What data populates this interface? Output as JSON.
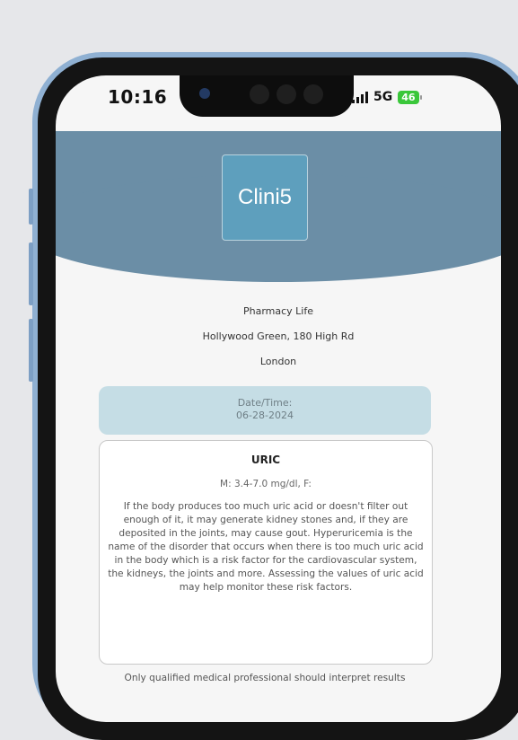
{
  "status_bar": {
    "time": "10:16",
    "network": "5G",
    "battery": "46"
  },
  "app": {
    "logo_text": "Clini5"
  },
  "pharmacy": {
    "name": "Pharmacy Life",
    "address": "Hollywood Green, 180 High Rd",
    "city": "London"
  },
  "date_time": {
    "label": "Date/Time:",
    "value": "06-28-2024"
  },
  "test_card": {
    "title": "URIC",
    "range": "M: 3.4-7.0 mg/dl, F:",
    "description": "If the body produces too much uric acid or doesn't filter out enough of it, it may generate kidney stones and, if they are deposited in the joints, may cause gout. Hyperuricemia is the name of the disorder that occurs when there is too much uric acid in the body which is a risk factor for the cardiovascular system, the kidneys, the joints and more. Assessing the values of uric acid may help monitor these risk factors."
  },
  "footer_note": "Only qualified medical professional should interpret results",
  "colors": {
    "header": "#6b8ea6",
    "logo_bg": "#5e9fbd",
    "date_box": "#c5dde5",
    "phone_frame": "#8fb0d2",
    "battery": "#3ac73a"
  }
}
